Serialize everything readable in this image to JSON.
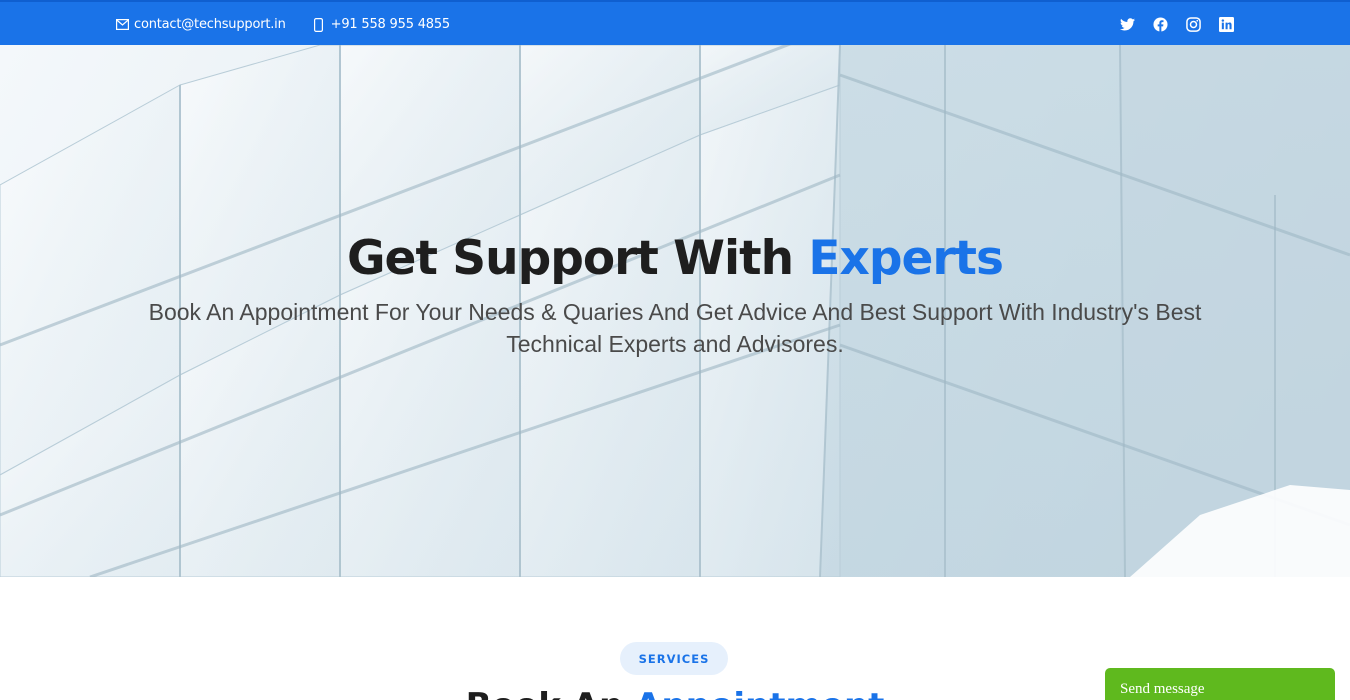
{
  "topbar": {
    "email": "contact@techsupport.in",
    "phone": "+91 558 955 4855",
    "email_icon": "envelope-icon",
    "phone_icon": "phone-icon",
    "social_icons": [
      "twitter-icon",
      "facebook-icon",
      "instagram-icon",
      "linkedin-icon"
    ]
  },
  "hero": {
    "title_main": "Get Support With",
    "title_accent": "Experts",
    "subtitle_line1": "Book An Appointment For Your Needs & Quaries And Get Advice And Best Support With Industry's Best",
    "subtitle_line2": "Technical Experts and Advisores."
  },
  "services": {
    "badge": "SERVICES",
    "title_main": "Book An",
    "title_accent": "Appointment"
  },
  "chat": {
    "label": "Send message"
  },
  "colors": {
    "brand_blue": "#1a73e8",
    "chat_green": "#5fb91e",
    "heading_dark": "#1e1e1e"
  }
}
